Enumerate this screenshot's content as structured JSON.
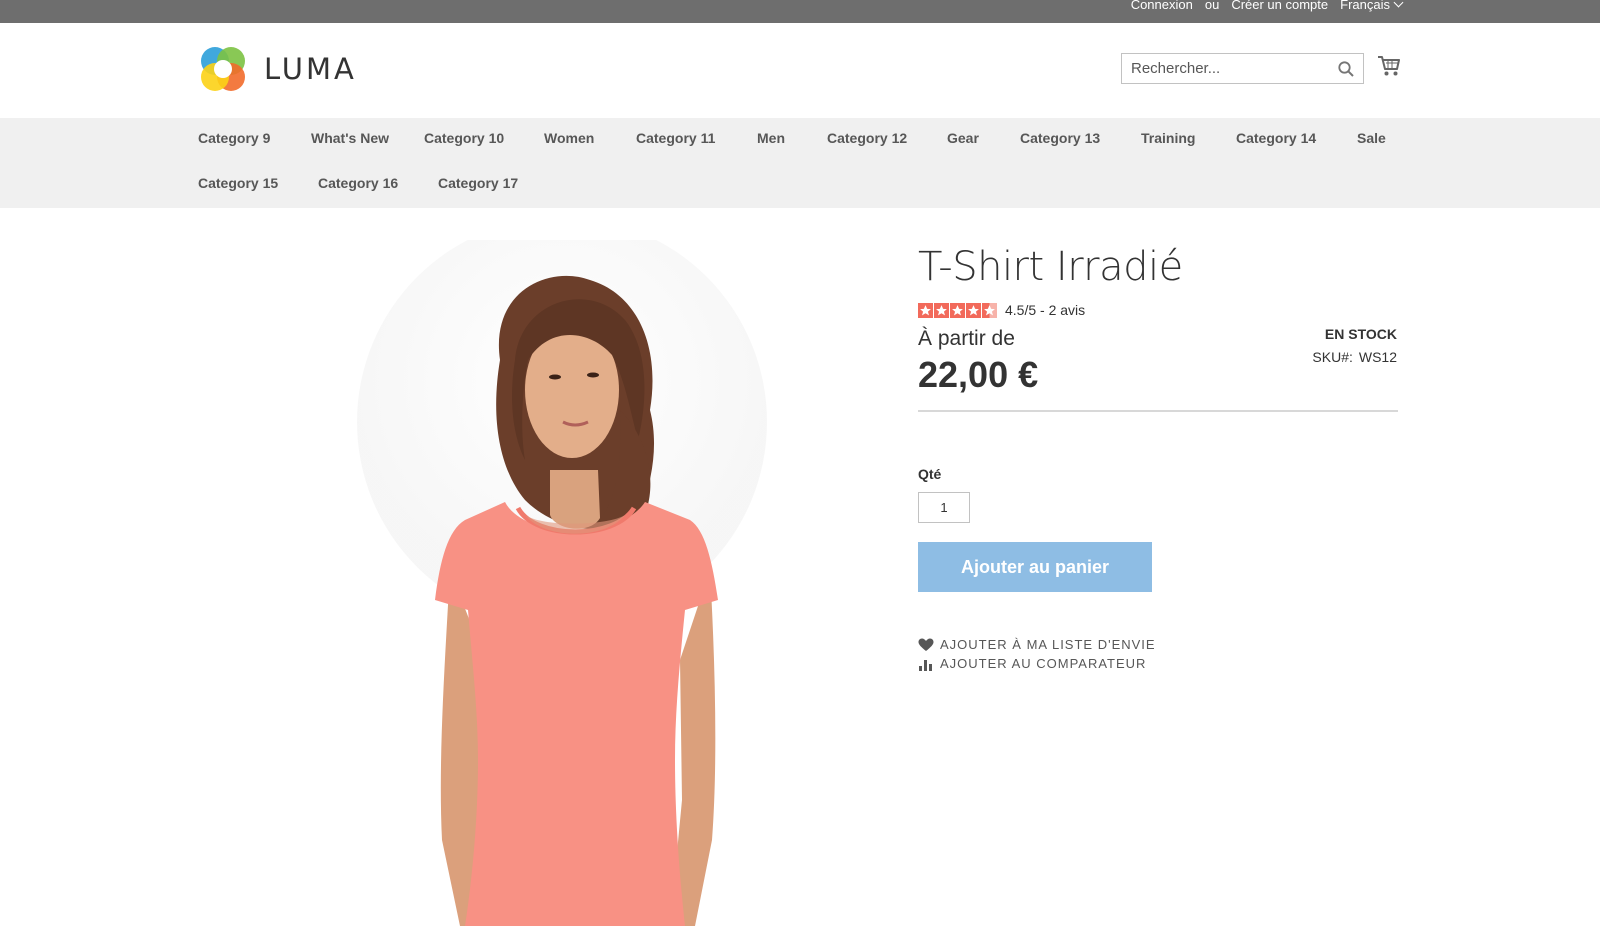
{
  "topbar": {
    "sign_in": "Connexion",
    "or": "ou",
    "create_account": "Créer un compte",
    "language": "Français"
  },
  "header": {
    "logo_text": "LUMA",
    "search_placeholder": "Rechercher..."
  },
  "nav": {
    "items": [
      "Category 9",
      "What's New",
      "Category 10",
      "Women",
      "Category 11",
      "Men",
      "Category 12",
      "Gear",
      "Category 13",
      "Training",
      "Category 14",
      "Sale",
      "Category 15",
      "Category 16",
      "Category 17"
    ]
  },
  "product": {
    "title": "T-Shirt Irradié",
    "rating": 4.5,
    "rating_text": "4.5/5 - 2 avis",
    "price_prefix": "À partir de",
    "price": "22,00 €",
    "stock": "EN STOCK",
    "sku_label": "SKU#:",
    "sku": "WS12",
    "qty_label": "Qté",
    "qty_value": "1",
    "add_to_cart": "Ajouter au panier",
    "wishlist": "AJOUTER À MA LISTE D'ENVIE",
    "compare": "AJOUTER AU COMPARATEUR"
  },
  "colors": {
    "accent_button": "#8ebde4",
    "star": "#f26a5b",
    "topbar": "#6e6e6e",
    "nav_bg": "#f0f0f0"
  }
}
